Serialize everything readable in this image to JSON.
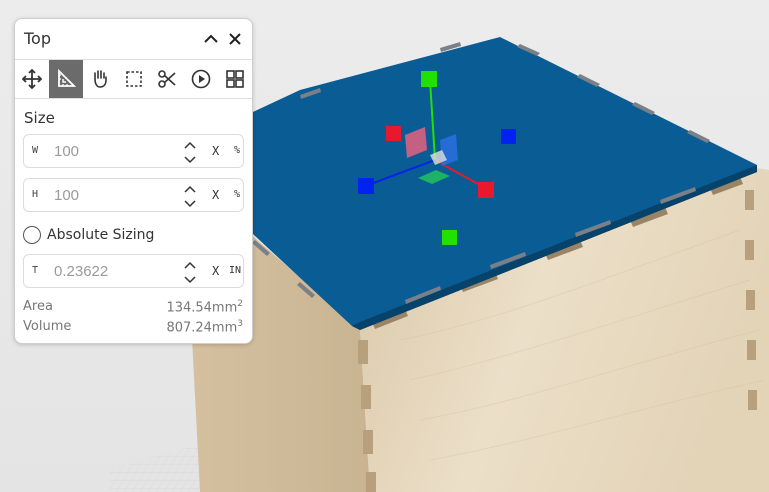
{
  "panel": {
    "title": "Top",
    "tools": [
      {
        "name": "move-icon",
        "active": false
      },
      {
        "name": "resize-icon",
        "active": true
      },
      {
        "name": "hand-icon",
        "active": false
      },
      {
        "name": "select-box-icon",
        "active": false
      },
      {
        "name": "scissors-icon",
        "active": false
      },
      {
        "name": "play-icon",
        "active": false
      },
      {
        "name": "grid-icon",
        "active": false
      }
    ],
    "size_label": "Size",
    "width": {
      "label": "W",
      "value": "100",
      "x": "X",
      "unit": "%"
    },
    "height": {
      "label": "H",
      "value": "100",
      "x": "X",
      "unit": "%"
    },
    "absolute_sizing_label": "Absolute Sizing",
    "absolute_sizing_checked": false,
    "thickness": {
      "label": "T",
      "value": "0.23622",
      "x": "X",
      "unit": "IN"
    },
    "area": {
      "label": "Area",
      "value": "134.54mm",
      "exp": "2"
    },
    "volume": {
      "label": "Volume",
      "value": "807.24mm",
      "exp": "3"
    }
  },
  "colors": {
    "panel_top": "#0a5c94",
    "wood": "#e6d7bd",
    "accent_active_tool": "#6b6b6b",
    "axis_x": "#e8192c",
    "axis_y": "#22e000",
    "axis_z": "#0022ee"
  }
}
